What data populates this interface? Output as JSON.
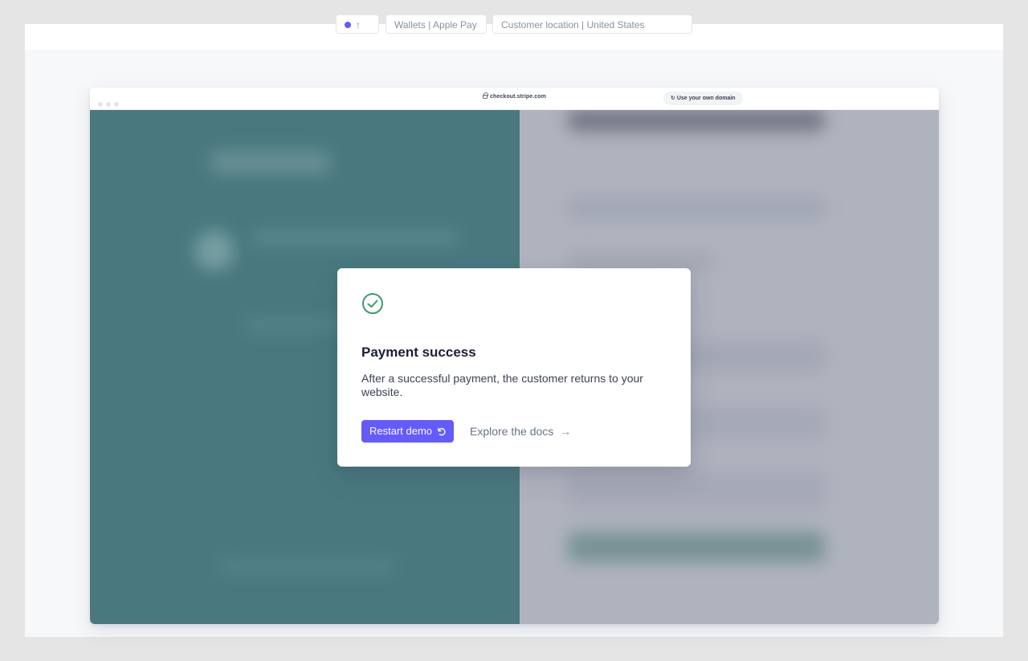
{
  "topbar": {
    "pill1": "↑",
    "pill2": "Wallets | Apple Pay",
    "pill3": "Customer location | United States"
  },
  "browser": {
    "url": "checkout.stripe.com",
    "domain_button": "Use your own domain",
    "domain_icon": "refresh-icon"
  },
  "modal": {
    "icon": "check-circle-icon",
    "title": "Payment success",
    "body": "After a successful payment, the customer returns to your website.",
    "restart_label": "Restart demo",
    "explore_label": "Explore the docs",
    "arrow": "→"
  },
  "colors": {
    "accent": "#635bff",
    "success": "#3a9c6b",
    "left_pane": "#4a7e83",
    "right_pane": "#b9bdc7"
  }
}
